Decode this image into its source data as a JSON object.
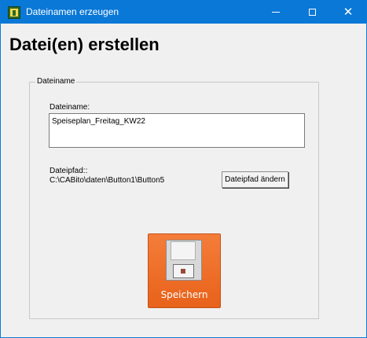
{
  "window": {
    "title": "Dateinamen erzeugen",
    "minimize_symbol": "",
    "maximize_symbol": "",
    "close_symbol": "✕"
  },
  "heading": "Datei(en) erstellen",
  "group": {
    "legend": "Dateiname",
    "filename_label": "Dateiname:",
    "filename_value": "Speiseplan_Freitag_KW22",
    "path_label": "Dateipfad::",
    "path_value": "C:\\CABito\\daten\\Button1\\Button5",
    "change_path_label": "Dateipfad ändern"
  },
  "save_button": {
    "label": "Speichern",
    "icon": "floppy-disk-icon"
  },
  "colors": {
    "titlebar": "#0a78d7",
    "save_button": "#f47d3a"
  }
}
